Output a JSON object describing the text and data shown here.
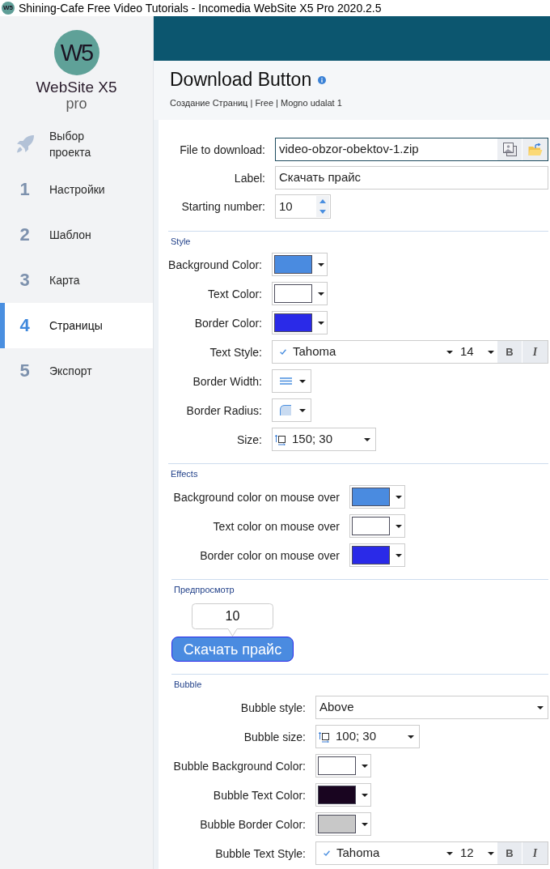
{
  "window": {
    "title": "Shining-Cafe Free Video Tutorials - Incomedia WebSite X5 Pro 2020.2.5",
    "icon_text": "W5"
  },
  "sidebar": {
    "logo": {
      "mark": "W5",
      "wordmark": "WebSite X5",
      "edition": "pro"
    },
    "items": [
      {
        "kind": "start",
        "label": "Выбор проекта",
        "selected": false
      },
      {
        "kind": "step",
        "number": "1",
        "label": "Настройки",
        "selected": false
      },
      {
        "kind": "step",
        "number": "2",
        "label": "Шаблон",
        "selected": false
      },
      {
        "kind": "step",
        "number": "3",
        "label": "Карта",
        "selected": false
      },
      {
        "kind": "step",
        "number": "4",
        "label": "Страницы",
        "selected": true
      },
      {
        "kind": "step",
        "number": "5",
        "label": "Экспорт",
        "selected": false
      }
    ]
  },
  "header": {
    "title": "Download Button",
    "subtitle": "Создание Страниц | Free | Mogno udalat 1"
  },
  "fields": [
    {
      "kind": "file",
      "label": "File to download:",
      "value": "video-obzor-obektov-1.zip",
      "focused": true
    },
    {
      "kind": "text",
      "label": "Label:",
      "value": "Скачать прайс",
      "focused": false
    },
    {
      "kind": "number",
      "label": "Starting number:",
      "value": "10",
      "focused": false
    }
  ],
  "sections": [
    {
      "kind": "style",
      "title": "Style",
      "rows": [
        {
          "kind": "color",
          "label": "Background Color:",
          "color": "#4a8be0"
        },
        {
          "kind": "color",
          "label": "Text Color:",
          "color": "#ffffff"
        },
        {
          "kind": "color",
          "label": "Border Color:",
          "color": "#2a2ae8"
        },
        {
          "kind": "font",
          "label": "Text Style:",
          "font": "Tahoma",
          "size": "14",
          "bold_button": "B",
          "italic_button": "I"
        },
        {
          "kind": "border_width",
          "label": "Border Width:"
        },
        {
          "kind": "border_radius",
          "label": "Border Radius:"
        },
        {
          "kind": "size",
          "label": "Size:",
          "value": "150; 30"
        }
      ]
    },
    {
      "kind": "effects",
      "title": "Effects",
      "rows": [
        {
          "kind": "color",
          "label": "Background color on mouse over",
          "color": "#4a8be0"
        },
        {
          "kind": "color",
          "label": "Text color on mouse over",
          "color": "#ffffff"
        },
        {
          "kind": "color",
          "label": "Border color on mouse over",
          "color": "#2a2ae8"
        }
      ]
    },
    {
      "kind": "preview",
      "title": "Предпросмотр",
      "bubble_text": "10",
      "button_label": "Скачать прайс"
    },
    {
      "kind": "bubble",
      "title": "Bubble",
      "rows": [
        {
          "kind": "select",
          "label": "Bubble style:",
          "value": "Above"
        },
        {
          "kind": "size",
          "label": "Bubble size:",
          "value": "100; 30"
        },
        {
          "kind": "color",
          "label": "Bubble Background Color:",
          "color": "#ffffff"
        },
        {
          "kind": "color",
          "label": "Bubble Text Color:",
          "color": "#190520"
        },
        {
          "kind": "color",
          "label": "Bubble Border Color:",
          "color": "#c8c8c8"
        },
        {
          "kind": "font",
          "label": "Bubble Text Style:",
          "font": "Tahoma",
          "size": "12",
          "bold_button": "B",
          "italic_button": "I"
        }
      ]
    }
  ]
}
